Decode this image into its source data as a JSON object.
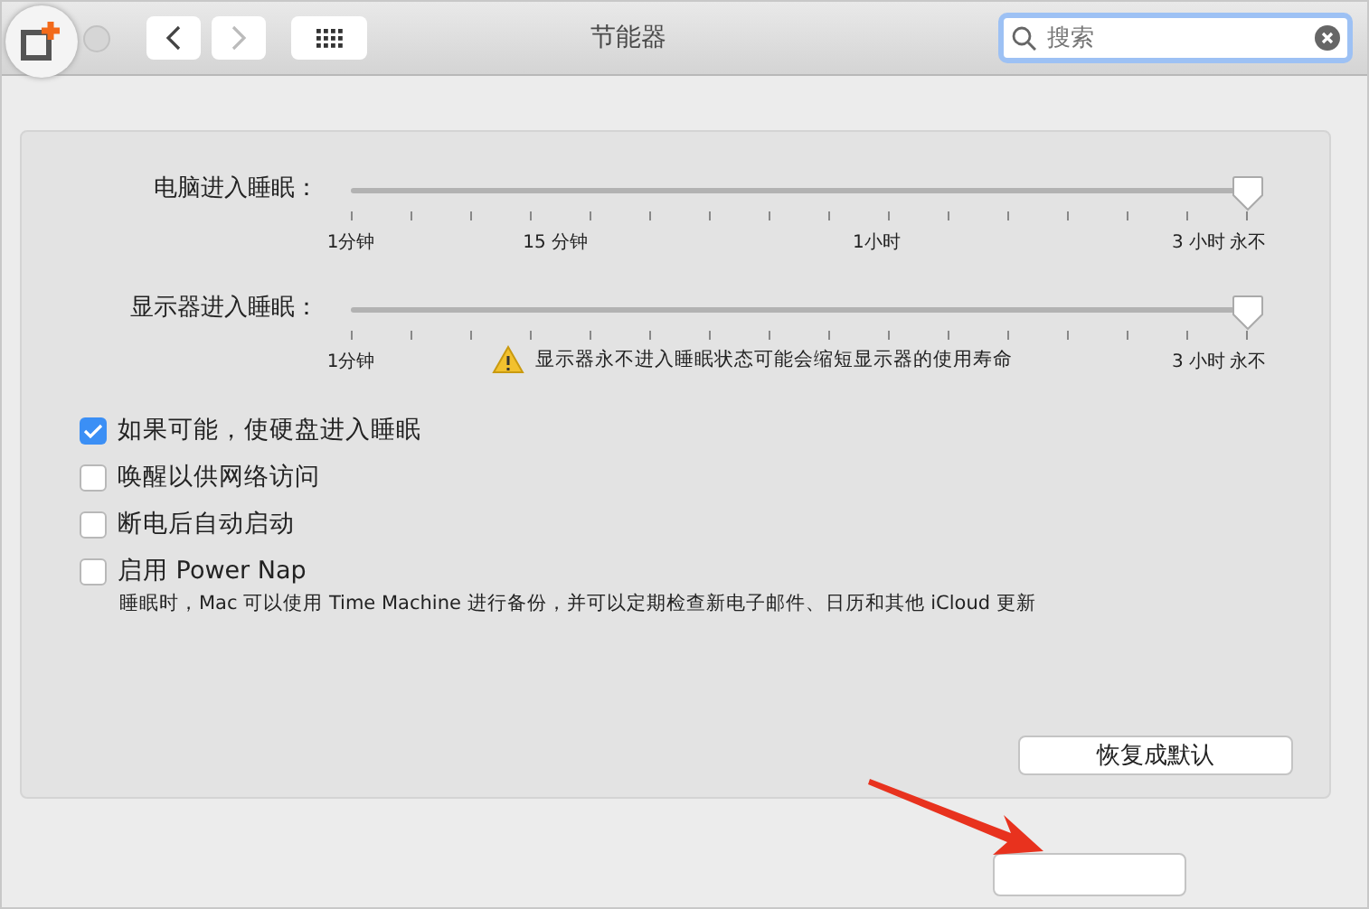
{
  "window": {
    "title": "节能器"
  },
  "search": {
    "placeholder": "搜索"
  },
  "sliders": [
    {
      "label": "电脑进入睡眠：",
      "level": 1,
      "ticks": [
        "1分钟",
        "15 分钟",
        "1小时",
        "3 小时",
        "永不"
      ]
    },
    {
      "label": "显示器进入睡眠：",
      "level": 1,
      "ticks": [
        "1分钟",
        "3 小时",
        "永不"
      ],
      "warning": "显示器永不进入睡眠状态可能会缩短显示器的使用寿命"
    }
  ],
  "options": [
    {
      "label": "如果可能，使硬盘进入睡眠",
      "checked": true
    },
    {
      "label": "唤醒以供网络访问",
      "checked": false
    },
    {
      "label": "断电后自动启动",
      "checked": false
    },
    {
      "label": "启用 Power Nap",
      "checked": false,
      "description": "睡眠时，Mac 可以使用 Time Machine 进行备份，并可以定期检查新电子邮件、日历和其他 iCloud 更新"
    }
  ],
  "restore_button": "恢复成默认"
}
